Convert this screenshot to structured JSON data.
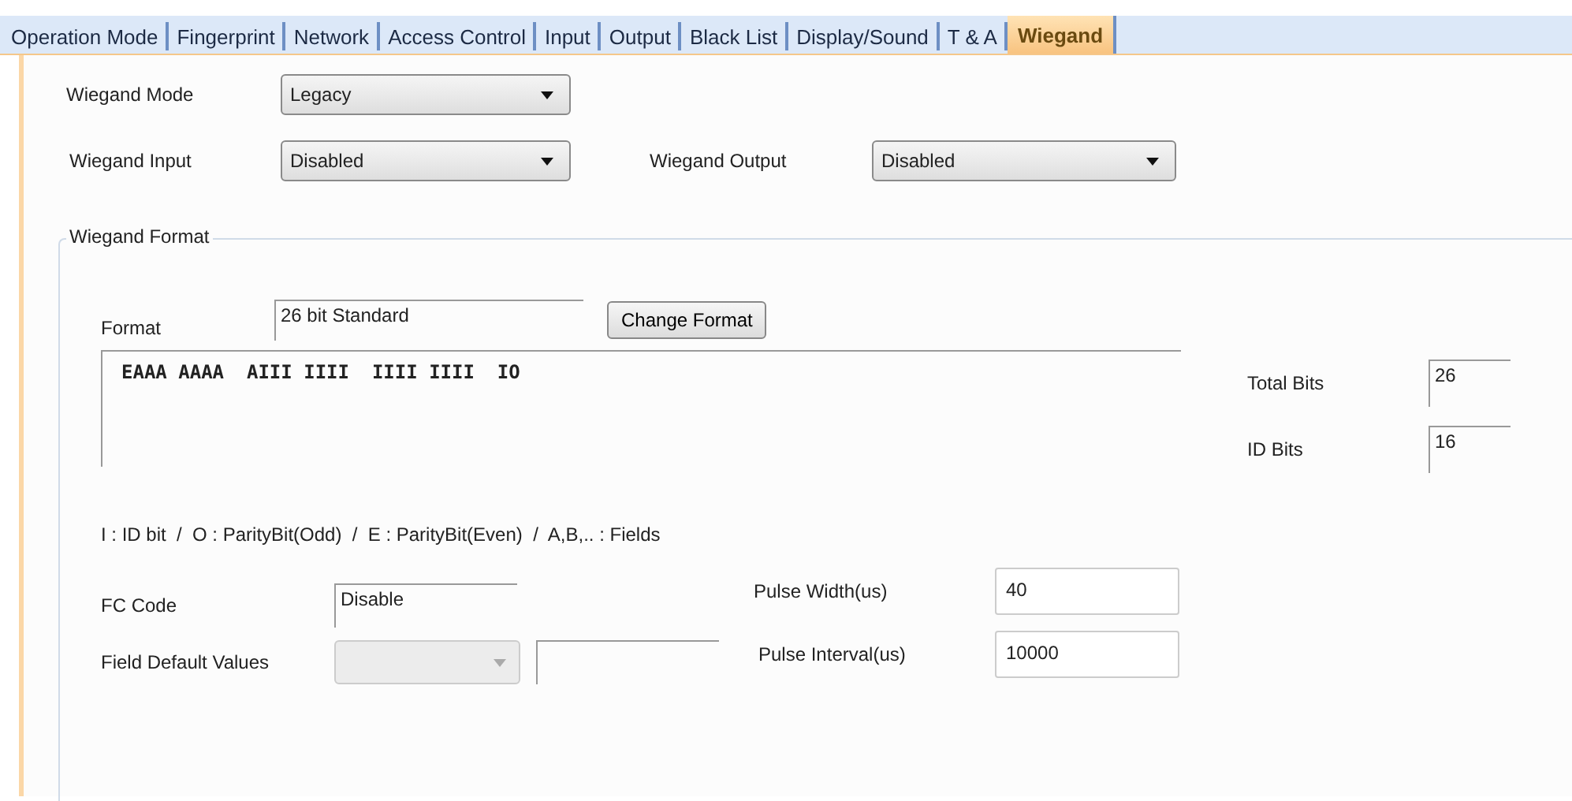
{
  "tabs": [
    {
      "label": "Operation Mode",
      "selected": false
    },
    {
      "label": "Fingerprint",
      "selected": false
    },
    {
      "label": "Network",
      "selected": false
    },
    {
      "label": "Access Control",
      "selected": false
    },
    {
      "label": "Input",
      "selected": false
    },
    {
      "label": "Output",
      "selected": false
    },
    {
      "label": "Black List",
      "selected": false
    },
    {
      "label": "Display/Sound",
      "selected": false
    },
    {
      "label": "T & A",
      "selected": false
    },
    {
      "label": "Wiegand",
      "selected": true
    }
  ],
  "wiegand_mode": {
    "label": "Wiegand Mode",
    "value": "Legacy"
  },
  "wiegand_input": {
    "label": "Wiegand Input",
    "value": "Disabled"
  },
  "wiegand_output": {
    "label": "Wiegand Output",
    "value": "Disabled"
  },
  "wiegand_format": {
    "title": "Wiegand Format",
    "format": {
      "label": "Format",
      "value": "26 bit Standard"
    },
    "change_button": "Change Format",
    "bit_pattern": "EAAA AAAA  AIII IIII  IIII IIII  IO",
    "total_bits": {
      "label": "Total Bits",
      "value": "26"
    },
    "id_bits": {
      "label": "ID Bits",
      "value": "16"
    },
    "legend": "I : ID bit  /  O : ParityBit(Odd)  /  E : ParityBit(Even)  /  A,B,.. : Fields",
    "fc_code": {
      "label": "FC Code",
      "value": "Disable"
    },
    "field_default_values": {
      "label": "Field Default Values",
      "disabled": true
    },
    "pulse_width": {
      "label": "Pulse Width(us)",
      "value": "40"
    },
    "pulse_interval": {
      "label": "Pulse Interval(us)",
      "value": "10000"
    }
  }
}
